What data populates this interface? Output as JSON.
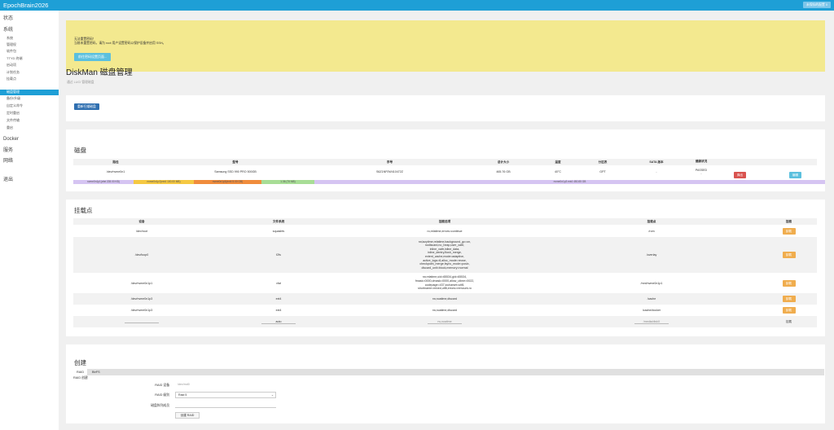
{
  "header": {
    "brand": "EpochBrain2026",
    "unsaved_label": "未保存的配置 0"
  },
  "sidebar": {
    "top": [
      "状态",
      "系统"
    ],
    "items": [
      "系统",
      "管理权",
      "软件包",
      "TTYD 终端",
      "启动项",
      "计划任务",
      "挂载点",
      "磁盘管理",
      "备份/升级",
      "自定义命令",
      "定时重启",
      "文件传输",
      "重启"
    ],
    "active_index": 7,
    "bottom": [
      "Docker",
      "服务",
      "网络",
      "退出"
    ]
  },
  "alert": {
    "title": "无法重置密码！",
    "text": "当前未重置密码，请为 root 用户设置密码以保护设备并启用 SSH。",
    "button": "前往密码设置页面..."
  },
  "page": {
    "title": "DiskMan 磁盘管理",
    "subtitle": "通过 LUCI 管理磁盘"
  },
  "rescan_button": "重新扫描磁盘",
  "disks": {
    "title": "磁盘",
    "columns": [
      "路径",
      "型号",
      "序号",
      "总计大小",
      "温度",
      "分区表",
      "SATA 版本",
      "健康状况",
      "",
      ""
    ],
    "rows": [
      {
        "path": "/dev/nvme0n1",
        "model": "Samsung SSD 990 PRO 500GB",
        "serial": "S6Z1NF0W410472Z",
        "size": "465.76 GB",
        "temp": "40°C",
        "table": "GPT",
        "sata": "-",
        "health": "PASSED",
        "health_sub": "-",
        "eject": "弹出",
        "edit": "编辑"
      }
    ],
    "partitions": [
      {
        "label": "nvme0n1p1(vfat 228.00 KB)",
        "color": "#d5c4f2",
        "fraction": 0.08
      },
      {
        "label": "nvme0n1p2(ext4 100.00 MB)",
        "color": "#f5c842",
        "fraction": 0.08
      },
      {
        "label": "nvme0n1p3(ext4 5.00 GB)",
        "color": "#f08c3c",
        "fraction": 0.09
      },
      {
        "label": "1.36 (75 MB)",
        "color": "#a8dd96",
        "fraction": 0.07
      },
      {
        "label": "nvme0n1p3 ext4 450.85 GB",
        "color": "#d5c4f2",
        "fraction": 0.68
      }
    ]
  },
  "mounts": {
    "title": "挂载点",
    "columns": [
      "设备",
      "文件系统",
      "挂载选项",
      "挂载点",
      "挂载"
    ],
    "rows": [
      {
        "device": "/dev/root",
        "fs": "squashfs",
        "options": [
          "ro,relatime,errors=continue"
        ],
        "mount": "/rom",
        "action": "卸载"
      },
      {
        "device": "/dev/loop0",
        "fs": "f2fs",
        "options": [
          "rw,lazytime,relatime,background_gc=on,",
          "nodiscard,no_heap,user_xattr,",
          "inline_xattr,inline_data,",
          "inline_dentry,flush_merge,",
          "extent_cache,mode=adaptive,",
          "active_logs=6,alloc_mode=reuse,",
          "checkpoint_merge,fsync_mode=posix,",
          "discard_unit=block,memory=normal"
        ],
        "mount": "/overlay",
        "action": "卸载"
      },
      {
        "device": "/dev/nvme0n1p1",
        "fs": "vfat",
        "options": [
          "rw,relatime,uid=65534,gid=65534,",
          "fmask=0000,dmask=0000,allow_utime=0022,",
          "codepage=437,iocharset=utf8,",
          "shortname=mixed,utf8,errors=remount-ro"
        ],
        "mount": "/mnt/nvme0n1p1",
        "action": "卸载"
      },
      {
        "device": "/dev/nvme0n1p3",
        "fs": "ext4",
        "options": [
          "rw,noatime,discard"
        ],
        "mount": "/cache",
        "action": "卸载"
      },
      {
        "device": "/dev/nvme0n1p3",
        "fs": "ext4",
        "options": [
          "rw,noatime,discard"
        ],
        "mount": "/cache/docker",
        "action": "卸载"
      }
    ],
    "new_row": {
      "device_placeholder": "",
      "fs_value": "auto",
      "options_placeholder": "rw,noatime",
      "mount_placeholder": "/media/diskX",
      "action": "挂载"
    }
  },
  "create": {
    "title": "创建",
    "tabs": [
      "RAID",
      "BtrFS"
    ],
    "subtitle": "RAID 创建",
    "fields": {
      "raid_device_label": "RAID 设备",
      "raid_device_placeholder": "/dev/md0",
      "raid_level_label": "RAID 级别",
      "raid_level_value": "Raid 5",
      "members_label": "磁盘阵列成员",
      "submit": "创建 RAID"
    }
  }
}
